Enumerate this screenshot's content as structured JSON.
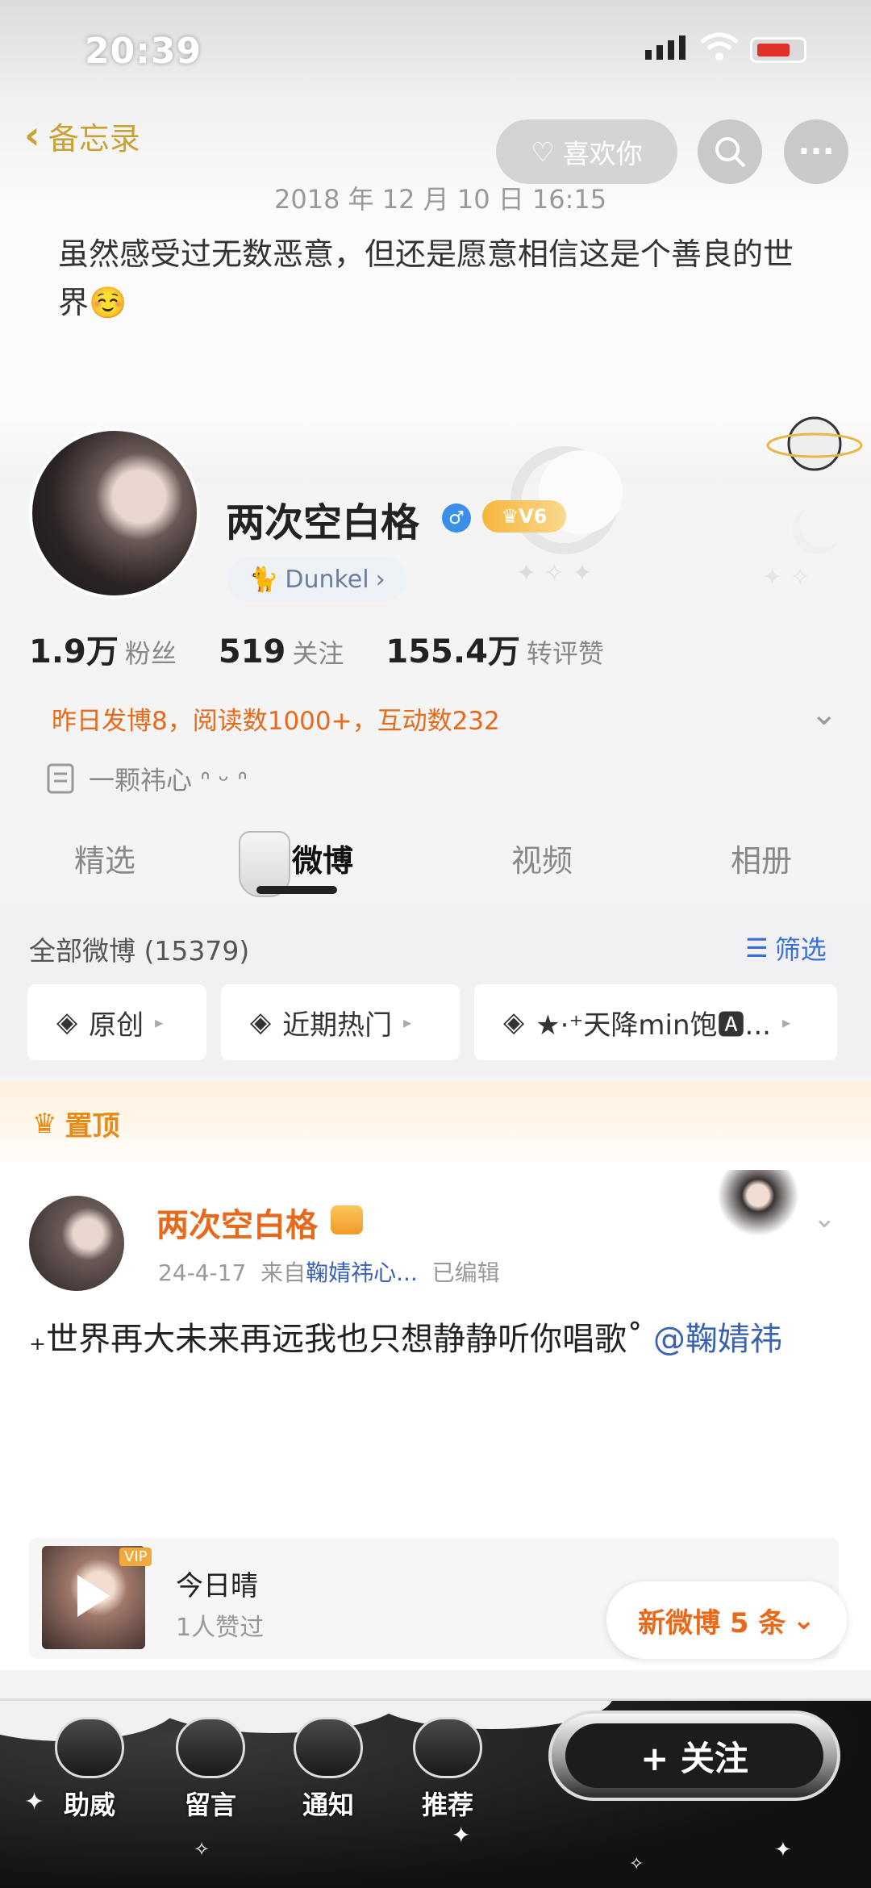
{
  "status": {
    "time": "20:39"
  },
  "memo_header": {
    "back_label": "备忘录",
    "like_label": "喜欢你"
  },
  "memo": {
    "date": "2018 年 12 月 10 日  16:15",
    "text": "虽然感受过无数恶意，但还是愿意相信这是个善良的世界☺️"
  },
  "profile": {
    "name": "两次空白格",
    "vip_level": "V6",
    "tag": "Dunkel",
    "stats": [
      {
        "num": "1.9万",
        "label": "粉丝"
      },
      {
        "num": "519",
        "label": "关注"
      },
      {
        "num": "155.4万",
        "label": "转评赞"
      }
    ],
    "yesterday": "昨日发博8，阅读数1000+，互动数232",
    "bio": "一颗祎心 ᐢ ᵕ ᐢ"
  },
  "tabs": [
    "精选",
    "微博",
    "视频",
    "相册"
  ],
  "feed": {
    "all_label": "全部微博 (15379)",
    "filter_label": "筛选",
    "chips": [
      "原创",
      "近期热门",
      "★·⁺天降min饱🅰..."
    ]
  },
  "pinned": {
    "label": "置顶"
  },
  "post": {
    "name": "两次空白格",
    "date": "24-4-17",
    "from_prefix": "来自",
    "source": "鞠婧祎心...",
    "edited": "已编辑",
    "text": "₊世界再大未来再远我也只想静静听你唱歌˚ ",
    "mention": "@鞠婧祎",
    "music": {
      "title": "今日晴",
      "likes": "1人赞过",
      "vip": "VIP"
    }
  },
  "new_weibo": "新微博 5 条",
  "bottom_nav": [
    "助威",
    "留言",
    "通知",
    "推荐"
  ],
  "follow": "+ 关注",
  "colors": {
    "accent_orange": "#e8691a",
    "link_blue": "#3a62b0",
    "gold": "#c9a235"
  }
}
